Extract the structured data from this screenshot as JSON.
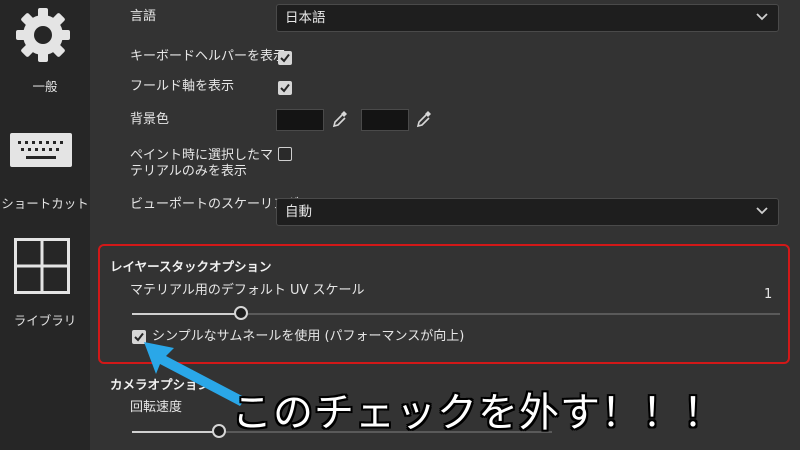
{
  "sidebar": {
    "items": [
      {
        "label": "一般",
        "icon": "gear-icon"
      },
      {
        "label": "ショートカット",
        "icon": "keyboard-icon"
      },
      {
        "label": "ライブラリ",
        "icon": "grid-icon"
      }
    ]
  },
  "settings": {
    "language": {
      "label": "言語",
      "value": "日本語"
    },
    "keyboard_helper": {
      "label": "キーボードヘルパーを表示",
      "checked": true
    },
    "fold_axis": {
      "label": "フールド軸を表示",
      "checked": true
    },
    "background": {
      "label": "背景色",
      "colors": [
        "#141414",
        "#141414"
      ]
    },
    "paint_selected": {
      "label_line1": "ペイント時に選択したマ",
      "label_line2": "テリアルのみを表示",
      "checked": false
    },
    "viewport_scaling": {
      "label": "ビューポートのスケーリング",
      "value": "自動"
    }
  },
  "layer_stack": {
    "title": "レイヤースタックオプション",
    "uv_scale": {
      "label": "マテリアル用のデフォルト UV スケール",
      "value": "1"
    },
    "simple_thumbnails": {
      "label": "シンプルなサムネールを使用 (パフォーマンスが向上)",
      "checked": true
    }
  },
  "camera": {
    "title": "カメラオプション",
    "rotation_speed": {
      "label": "回転速度"
    }
  },
  "annotation": {
    "callout_text": "このチェックを外す！！！",
    "box_color": "#d21818",
    "arrow_color": "#2aa7e8"
  }
}
